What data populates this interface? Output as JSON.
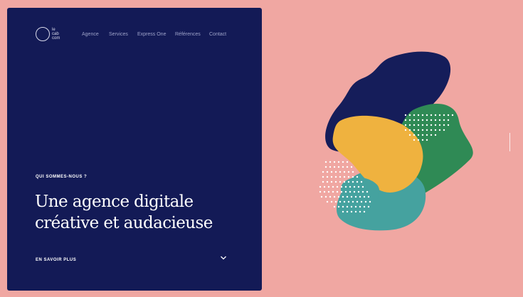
{
  "logo": {
    "text": "le\ncab\ncom"
  },
  "nav": {
    "items": [
      {
        "label": "Agence"
      },
      {
        "label": "Services"
      },
      {
        "label": "Express One"
      },
      {
        "label": "Références"
      },
      {
        "label": "Contact"
      }
    ]
  },
  "hero": {
    "eyebrow": "QUI SOMMES-NOUS ?",
    "headline_line1": "Une agence digitale",
    "headline_line2": "créative et audacieuse",
    "cta_label": "EN SAVOIR PLUS"
  },
  "colors": {
    "page_background": "#f0a7a2",
    "panel": "#131a56",
    "blob_navy": "#151d5a",
    "blob_green": "#2f8a55",
    "blob_yellow": "#efb23f",
    "blob_teal": "#45a29f"
  },
  "icons": {
    "cta": "chevron-down-icon",
    "logo": "crescent-circle-icon"
  }
}
